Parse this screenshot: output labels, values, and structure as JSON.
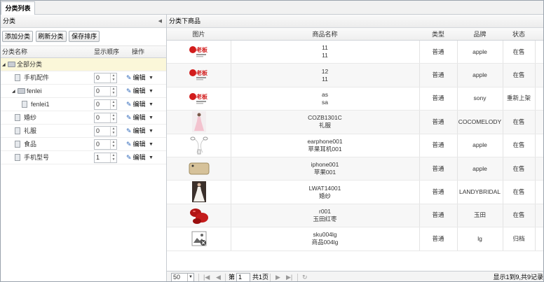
{
  "tab": {
    "label": "分类列表"
  },
  "left_panel": {
    "title": "分类",
    "buttons": {
      "add": "添加分类",
      "refresh": "刷新分类",
      "save_order": "保存排序"
    },
    "columns": {
      "name": "分类名称",
      "order": "显示顺序",
      "action": "操作"
    },
    "edit_label": "编辑",
    "rows": [
      {
        "name": "全部分类",
        "type": "root",
        "order": ""
      },
      {
        "name": "手机配件",
        "type": "leaf",
        "order": "0"
      },
      {
        "name": "fenlei",
        "type": "folder",
        "order": "0"
      },
      {
        "name": "fenlei1",
        "type": "leaf",
        "order": "0"
      },
      {
        "name": "婚纱",
        "type": "leaf",
        "order": "0"
      },
      {
        "name": "礼服",
        "type": "leaf",
        "order": "0"
      },
      {
        "name": "食品",
        "type": "leaf",
        "order": "0"
      },
      {
        "name": "手机型号",
        "type": "leaf",
        "order": "1"
      }
    ]
  },
  "right_panel": {
    "title": "分类下商品",
    "columns": {
      "image": "图片",
      "name": "商品名称",
      "type": "类型",
      "brand": "品牌",
      "status": "状态"
    },
    "rows": [
      {
        "code": "11",
        "name": "11",
        "type": "普通",
        "brand": "apple",
        "status": "在售",
        "thumb": "logo"
      },
      {
        "code": "12",
        "name": "11",
        "type": "普通",
        "brand": "apple",
        "status": "在售",
        "thumb": "logo"
      },
      {
        "code": "as",
        "name": "sa",
        "type": "普通",
        "brand": "sony",
        "status": "重新上架",
        "thumb": "logo"
      },
      {
        "code": "COZB1301C",
        "name": "礼服",
        "type": "普通",
        "brand": "COCOMELODY",
        "status": "在售",
        "thumb": "dress"
      },
      {
        "code": "earphone001",
        "name": "苹果耳机001",
        "type": "普通",
        "brand": "apple",
        "status": "在售",
        "thumb": "earphone"
      },
      {
        "code": "iphone001",
        "name": "苹果001",
        "type": "普通",
        "brand": "apple",
        "status": "在售",
        "thumb": "phone"
      },
      {
        "code": "LWAT14001",
        "name": "婚纱",
        "type": "普通",
        "brand": "LANDYBRIDAL",
        "status": "在售",
        "thumb": "gown"
      },
      {
        "code": "r001",
        "name": "玉田红枣",
        "type": "普通",
        "brand": "玉田",
        "status": "在售",
        "thumb": "dates"
      },
      {
        "code": "sku004lg",
        "name": "商品004lg",
        "type": "普通",
        "brand": "lg",
        "status": "归档",
        "thumb": "noimage"
      }
    ]
  },
  "pager": {
    "page_size": "50",
    "page_prefix": "第",
    "page_value": "1",
    "page_suffix": "共1页",
    "summary": "显示1到9,共9记录"
  },
  "colors": {
    "selected_row": "#fbf7d9",
    "edit_icon": "#2a64b8",
    "logo_red": "#d21c1c"
  }
}
